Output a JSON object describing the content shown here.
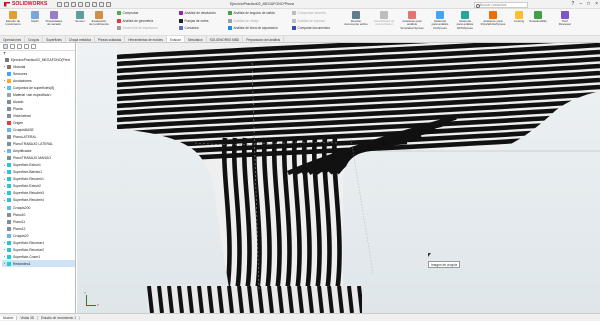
{
  "app": {
    "brand": "SOLIDWORKS",
    "window_title": "EjercicioPractico02_MEGAFONO*Pieza",
    "search_placeholder": "Buscar comandos"
  },
  "ribbon": {
    "big_buttons": [
      {
        "label": "Estudio de\nmovimiento"
      },
      {
        "label": "Medir"
      },
      {
        "label": "Propiedades\nde secado"
      },
      {
        "label": "Sensor"
      },
      {
        "label": "Evaluación\nde rendimiento"
      }
    ],
    "small_col1": [
      "Comprobar",
      "Análisis de geometría",
      "Geometría de espesores"
    ],
    "small_col2": [
      "Análisis de desviación",
      "Franjas de cebra",
      "Curvatura"
    ],
    "small_col3": [
      "Análisis de ángulos de salida",
      "Análisis de rebaje",
      "Análisis de línea de separación"
    ],
    "small_col4": [
      "Comprobar simetría",
      "Análisis de espesor",
      "Comparar documentos"
    ],
    "right_buttons": [
      {
        "label": "Revisar\ndocumento activo",
        "dim": false
      },
      {
        "label": "Sensibilidad de\ncomprobador",
        "dim": true
      },
      {
        "label": "Asistente para\nanálisis\nSimulationXpress",
        "dim": false
      },
      {
        "label": "Asistente\npara análisis\nFloXpress",
        "dim": false
      },
      {
        "label": "Asistente\npara análisis\nDFMXpress",
        "dim": false
      },
      {
        "label": "Asistente para\nDriveWorksXpress",
        "dim": false
      },
      {
        "label": "Costing",
        "dim": false
      },
      {
        "label": "Sustainability",
        "dim": false
      },
      {
        "label": "Part\nReviewer",
        "dim": false
      }
    ]
  },
  "tabs": [
    "Operaciones",
    "Croquis",
    "Superficies",
    "Chapa metálica",
    "Piezas soldadas",
    "Herramientas de moldes",
    "Evaluar",
    "Simulation",
    "SOLIDWORKS MBD",
    "Preparación del análisis"
  ],
  "active_tab": "Evaluar",
  "tree": [
    {
      "label": "EjercicioPractico02_MEGAFONO(Pred",
      "color": "#7a7a7a",
      "arrow": "",
      "top": true
    },
    {
      "label": "Historial",
      "color": "#8d6e63",
      "arrow": "▸"
    },
    {
      "label": "Sensores",
      "color": "#42a5f5",
      "arrow": ""
    },
    {
      "label": "Anotaciones",
      "color": "#f9a825",
      "arrow": "▸"
    },
    {
      "label": "Conjuntos de superficies(8)",
      "color": "#4fc3f7",
      "arrow": "▸"
    },
    {
      "label": "Material <sin especificar>",
      "color": "#90a4ae",
      "arrow": ""
    },
    {
      "label": "Alzado",
      "color": "#78909c",
      "arrow": ""
    },
    {
      "label": "Planta",
      "color": "#78909c",
      "arrow": ""
    },
    {
      "label": "Vista lateral",
      "color": "#78909c",
      "arrow": ""
    },
    {
      "label": "Origen",
      "color": "#e53935",
      "arrow": ""
    },
    {
      "label": "CroquisBASE",
      "color": "#64b5f6",
      "arrow": ""
    },
    {
      "label": "PlanoLATERAL",
      "color": "#78909c",
      "arrow": ""
    },
    {
      "label": "PlanoTRABAJO LATERAL",
      "color": "#78909c",
      "arrow": ""
    },
    {
      "label": "Amplificador",
      "color": "#64b5f6",
      "arrow": "▸"
    },
    {
      "label": "PlanoTRABAJO MANGO",
      "color": "#78909c",
      "arrow": ""
    },
    {
      "label": "Superficie-Extruir1",
      "color": "#26c6da",
      "arrow": "▸"
    },
    {
      "label": "Superficie-Barrido1",
      "color": "#26c6da",
      "arrow": "▸"
    },
    {
      "label": "Superficie-Recubrir1",
      "color": "#26c6da",
      "arrow": "▸"
    },
    {
      "label": "Superficie-Extruir2",
      "color": "#26c6da",
      "arrow": "▸"
    },
    {
      "label": "Superficie-Recubrir3",
      "color": "#26c6da",
      "arrow": "▸"
    },
    {
      "label": "Superficie-Recubrir4",
      "color": "#26c6da",
      "arrow": "▸"
    },
    {
      "label": "Croquis200",
      "color": "#64b5f6",
      "arrow": ""
    },
    {
      "label": "Plano10",
      "color": "#78909c",
      "arrow": ""
    },
    {
      "label": "Plano11",
      "color": "#78909c",
      "arrow": ""
    },
    {
      "label": "Plano12",
      "color": "#78909c",
      "arrow": ""
    },
    {
      "label": "Croquis20",
      "color": "#64b5f6",
      "arrow": ""
    },
    {
      "label": "Superficie-Recortar1",
      "color": "#26c6da",
      "arrow": "▸"
    },
    {
      "label": "Superficie-Recortar2",
      "color": "#26c6da",
      "arrow": "▸"
    },
    {
      "label": "Superficie-Coser1",
      "color": "#26c6da",
      "arrow": "▸"
    },
    {
      "label": "Redondeo1",
      "color": "#26c6da",
      "arrow": "▸",
      "selected": true
    }
  ],
  "bottom_tabs": [
    "Modelo",
    "Vistas 3D",
    "Estudio de movimiento 1"
  ],
  "viewport": {
    "tooltip": "Imagen de croquis",
    "triad": {
      "x": "X",
      "y": "Y"
    }
  }
}
